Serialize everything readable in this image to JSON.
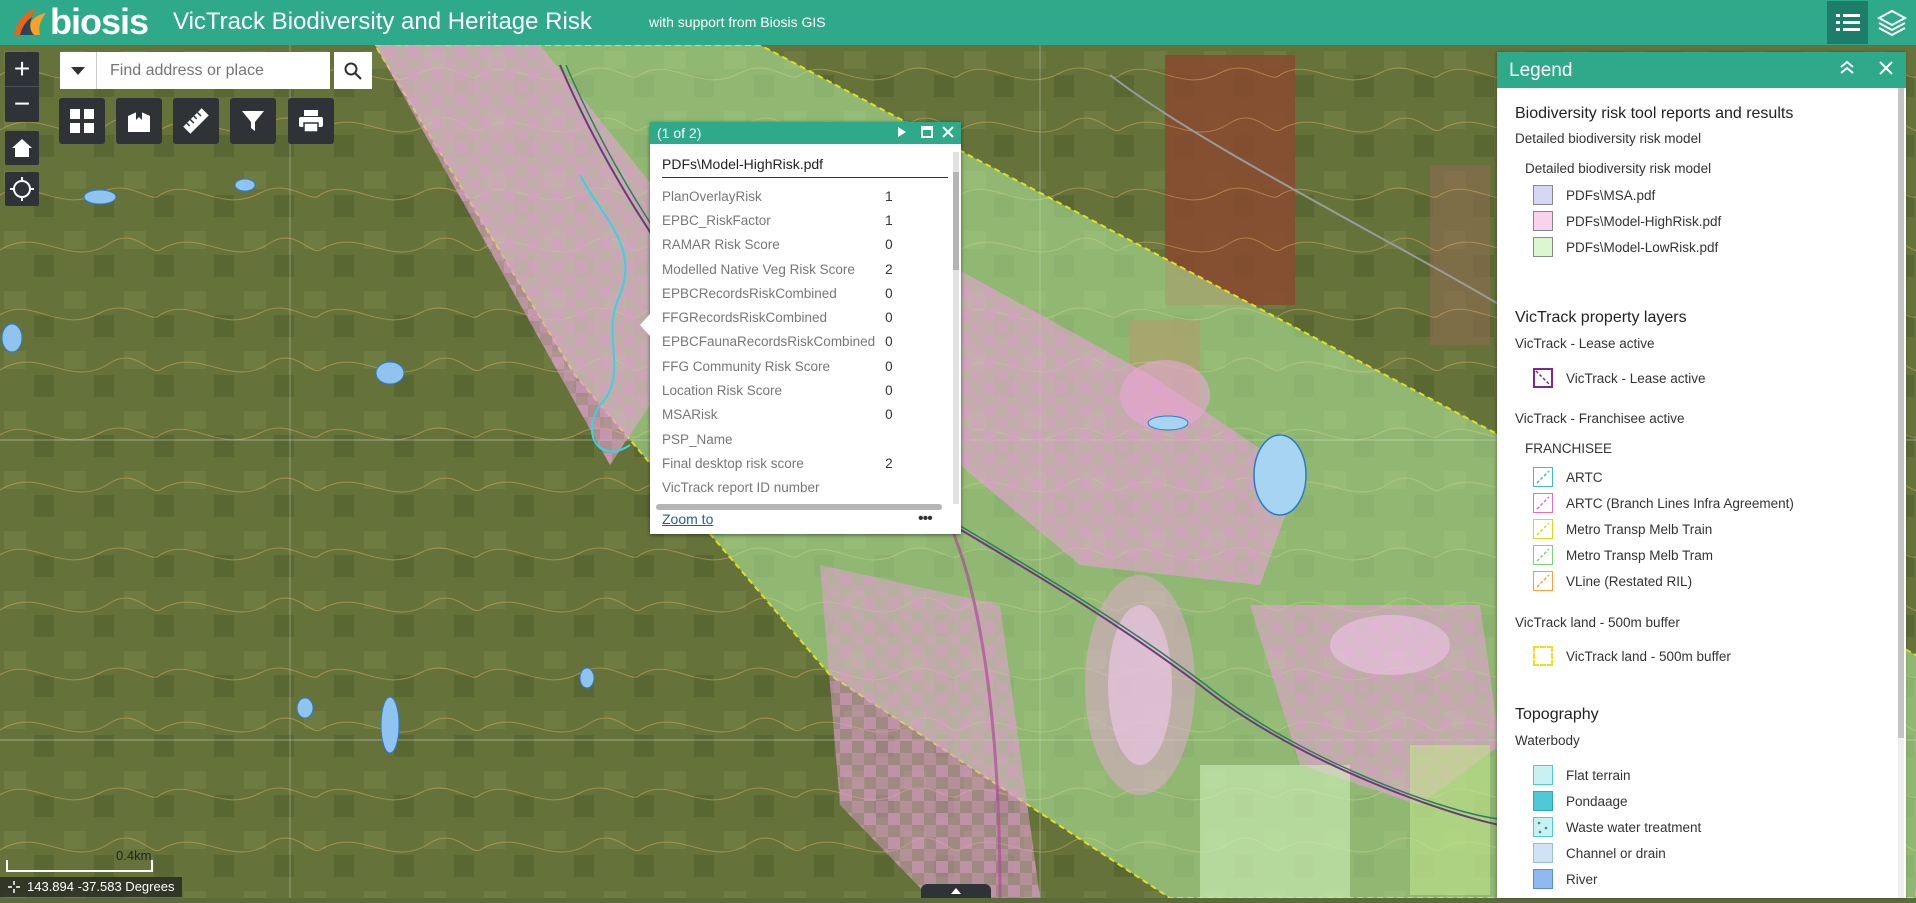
{
  "header": {
    "logo_text": "biosis",
    "title": "VicTrack Biodiversity and Heritage Risk",
    "subtitle": "with support from Biosis GIS",
    "accent_color": "#2ea98a"
  },
  "search": {
    "placeholder": "Find address or place",
    "value": ""
  },
  "toolbar": {
    "zoom_in": "+",
    "zoom_out": "−",
    "tools": [
      "basemap-gallery-icon",
      "bookmark-icon",
      "measure-icon",
      "filter-icon",
      "print-icon"
    ]
  },
  "popup": {
    "count": "(1 of 2)",
    "title": "PDFs\\Model-HighRisk.pdf",
    "fields": [
      {
        "label": "PlanOverlayRisk",
        "value": "1"
      },
      {
        "label": "EPBC_RiskFactor",
        "value": "1"
      },
      {
        "label": "RAMAR Risk Score",
        "value": "0"
      },
      {
        "label": "Modelled Native Veg Risk Score",
        "value": "2"
      },
      {
        "label": "EPBCRecordsRiskCombined",
        "value": "0"
      },
      {
        "label": "FFGRecordsRiskCombined",
        "value": "0"
      },
      {
        "label": "EPBCFaunaRecordsRiskCombined",
        "value": "0"
      },
      {
        "label": "FFG Community Risk Score",
        "value": "0"
      },
      {
        "label": "Location Risk Score",
        "value": "0"
      },
      {
        "label": "MSARisk",
        "value": "0"
      },
      {
        "label": "PSP_Name",
        "value": ""
      },
      {
        "label": "Final desktop risk score",
        "value": "2"
      },
      {
        "label": "VicTrack report ID number",
        "value": ""
      }
    ],
    "zoom_link": "Zoom to",
    "more": "•••"
  },
  "legend": {
    "title": "Legend",
    "sections": {
      "bio_heading": "Biodiversity risk tool reports and results",
      "bio_layer": "Detailed biodiversity risk model",
      "bio_sublayer": "Detailed biodiversity risk model",
      "bio_items": [
        {
          "label": "PDFs\\MSA.pdf",
          "color": "#d6d6f5"
        },
        {
          "label": "PDFs\\Model-HighRisk.pdf",
          "color": "#f9d3ee"
        },
        {
          "label": "PDFs\\Model-LowRisk.pdf",
          "color": "#dcf7cf"
        }
      ],
      "prop_heading": "VicTrack property layers",
      "lease_layer": "VicTrack - Lease active",
      "lease_item": {
        "label": "VicTrack - Lease active",
        "color": "#7a2a8c"
      },
      "franch_layer": "VicTrack - Franchisee active",
      "franch_field": "FRANCHISEE",
      "franch_items": [
        {
          "label": "ARTC",
          "color": "#45b8cf"
        },
        {
          "label": "ARTC (Branch Lines Infra Agreement)",
          "color": "#e56fbf"
        },
        {
          "label": "Metro Transp Melb Train",
          "color": "#e0d51c"
        },
        {
          "label": "Metro Transp Melb Tram",
          "color": "#7fd37a"
        },
        {
          "label": "VLine (Restated RIL)",
          "color": "#f0a340"
        }
      ],
      "buffer_layer": "VicTrack land - 500m buffer",
      "buffer_item": {
        "label": "VicTrack land - 500m buffer",
        "color": "#e7e21a"
      },
      "topo_heading": "Topography",
      "water_layer": "Waterbody",
      "water_items": [
        {
          "label": "Flat terrain",
          "color": "#c9f1f1"
        },
        {
          "label": "Pondaage",
          "color": "#4fc9d6"
        },
        {
          "label": "Waste water treatment",
          "color": "#c9f1f1"
        },
        {
          "label": "Channel or drain",
          "color": "#cfe3f5"
        },
        {
          "label": "River",
          "color": "#8fb9f0"
        }
      ]
    }
  },
  "status": {
    "scale_label": "0.4km",
    "coordinates": "143.894 -37.583 Degrees"
  }
}
